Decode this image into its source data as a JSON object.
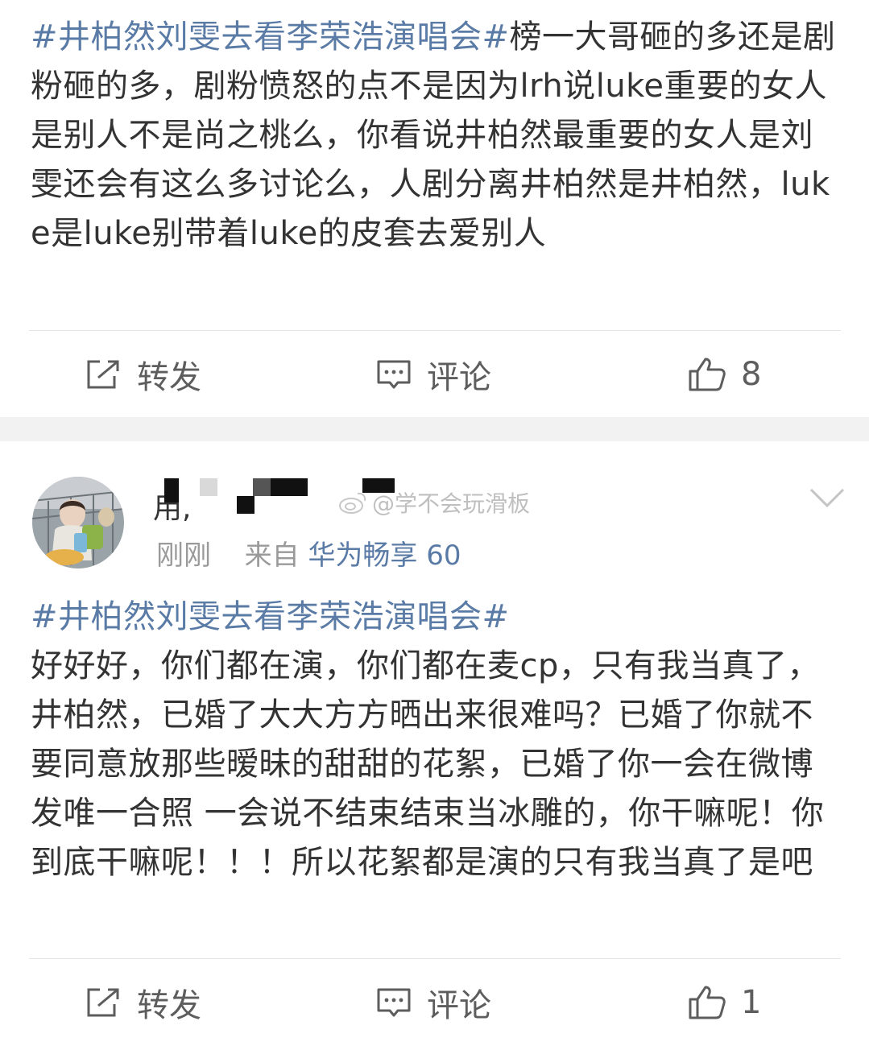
{
  "post1": {
    "topic": "#井柏然刘雯去看李荣浩演唱会#",
    "body": "榜一大哥砸的多还是剧粉砸的多，剧粉愤怒的点不是因为lrh说luke重要的女人是别人不是尚之桃么，你看说井柏然最重要的女人是刘雯还会有这么多讨论么，人剧分离井柏然是井柏然，luke是luke别带着luke的皮套去爱别人",
    "actions": {
      "repost_label": "转发",
      "comment_label": "评论",
      "like_count": "8"
    }
  },
  "post2": {
    "username_fragment": "用,",
    "watermark": "@学不会玩滑板",
    "time": "刚刚",
    "from_label": "来自",
    "source": "华为畅享 60",
    "topic": "#井柏然刘雯去看李荣浩演唱会#",
    "body": "好好好，你们都在演，你们都在麦cp，只有我当真了，井柏然，已婚了大大方方晒出来很难吗？已婚了你就不要同意放那些暧昧的甜甜的花絮，已婚了你一会在微博发唯一合照 一会说不结束结束当冰雕的，你干嘛呢！你到底干嘛呢！！！所以花絮都是演的只有我当真了是吧",
    "actions": {
      "repost_label": "转发",
      "comment_label": "评论",
      "like_count": "1"
    }
  },
  "colors": {
    "topic": "#5a7ba6",
    "text": "#333333",
    "meta": "#9a9a9a",
    "divider": "#e6e6e6",
    "gap": "#f2f2f2"
  },
  "icons": [
    "repost-icon",
    "comment-icon",
    "like-icon",
    "chevron-down-icon",
    "weibo-logo-icon"
  ]
}
